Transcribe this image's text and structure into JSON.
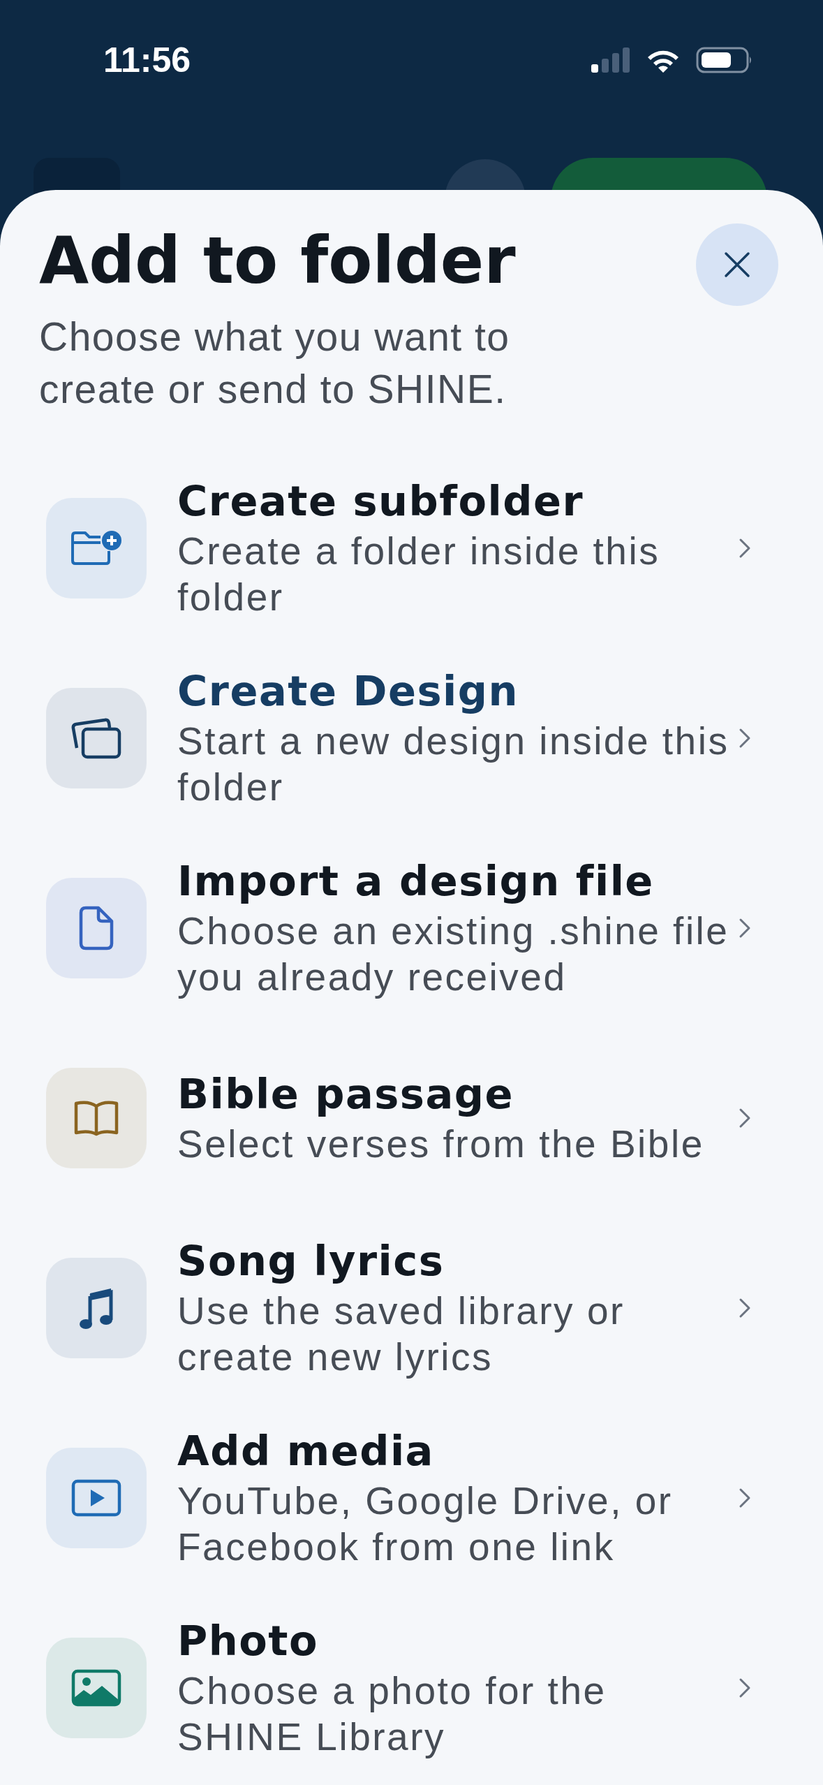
{
  "status_bar": {
    "time": "11:56"
  },
  "sheet": {
    "title": "Add to folder",
    "subtitle": "Choose what you want to create or send to SHINE.",
    "options": [
      {
        "kind": "folder-plus",
        "title": "Create subfolder",
        "description": "Create a folder inside this folder",
        "highlighted": false,
        "color": "#1f6bb5"
      },
      {
        "kind": "cards",
        "title": "Create Design",
        "description": "Start a new design inside this folder",
        "highlighted": true,
        "color": "#163d63"
      },
      {
        "kind": "file",
        "title": "Import a design file",
        "description": "Choose an existing .shine file you already received",
        "highlighted": false,
        "color": "#3563bf"
      },
      {
        "kind": "book",
        "title": "Bible passage",
        "description": "Select verses from the Bible",
        "highlighted": false,
        "color": "#8a6420"
      },
      {
        "kind": "music",
        "title": "Song lyrics",
        "description": "Use the saved library or create new lyrics",
        "highlighted": false,
        "color": "#184a7c"
      },
      {
        "kind": "video",
        "title": "Add media",
        "description": "YouTube, Google Drive, or Facebook from one link",
        "highlighted": false,
        "color": "#1f6bb5"
      },
      {
        "kind": "photo",
        "title": "Photo",
        "description": "Choose a photo for the SHINE Library",
        "highlighted": false,
        "color": "#0f7a68"
      }
    ]
  }
}
